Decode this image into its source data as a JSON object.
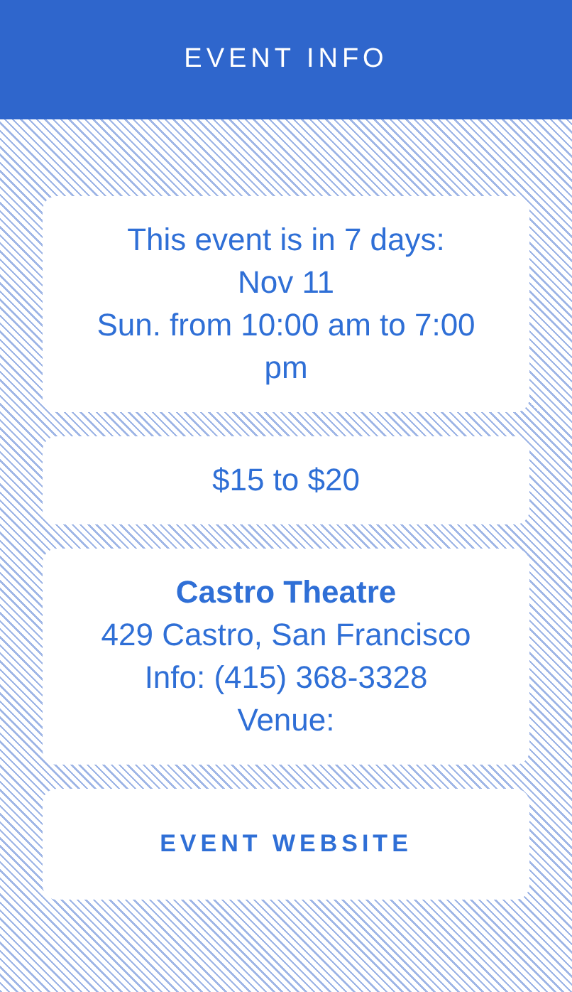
{
  "header": {
    "title": "EVENT INFO"
  },
  "cards": [
    {
      "kind": "text",
      "lines": [
        "This event is in 7 days:",
        "Nov 11",
        "Sun. from 10:00 am to 7:00 pm"
      ]
    },
    {
      "kind": "text",
      "lines": [
        "$15 to $20"
      ]
    },
    {
      "kind": "venue",
      "name": "Castro Theatre",
      "lines": [
        "429 Castro, San Francisco",
        "Info: (415) 368-3328",
        "Venue:"
      ]
    },
    {
      "kind": "link",
      "label": "EVENT WEBSITE"
    }
  ]
}
